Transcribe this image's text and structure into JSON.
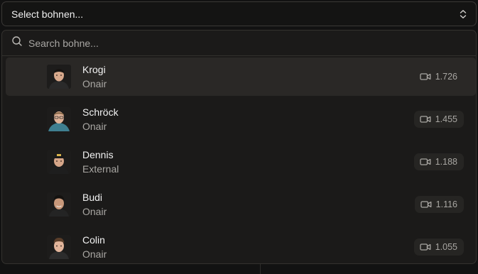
{
  "select": {
    "label": "Select bohnen...",
    "icon": "chevron-up-down-icon"
  },
  "search": {
    "placeholder": "Search bohne...",
    "value": "",
    "icon": "search-icon"
  },
  "options": [
    {
      "name": "Krogi",
      "sub": "Onair",
      "count": "1.726",
      "highlighted": true,
      "avatar": "krogi"
    },
    {
      "name": "Schröck",
      "sub": "Onair",
      "count": "1.455",
      "highlighted": false,
      "avatar": "schroeck"
    },
    {
      "name": "Dennis",
      "sub": "External",
      "count": "1.188",
      "highlighted": false,
      "avatar": "dennis"
    },
    {
      "name": "Budi",
      "sub": "Onair",
      "count": "1.116",
      "highlighted": false,
      "avatar": "budi"
    },
    {
      "name": "Colin",
      "sub": "Onair",
      "count": "1.055",
      "highlighted": false,
      "avatar": "colin"
    }
  ],
  "colors": {
    "background": "#121212",
    "panel": "#1b1a19",
    "highlight": "#2a2826",
    "muted_text": "#a9a7a3"
  }
}
